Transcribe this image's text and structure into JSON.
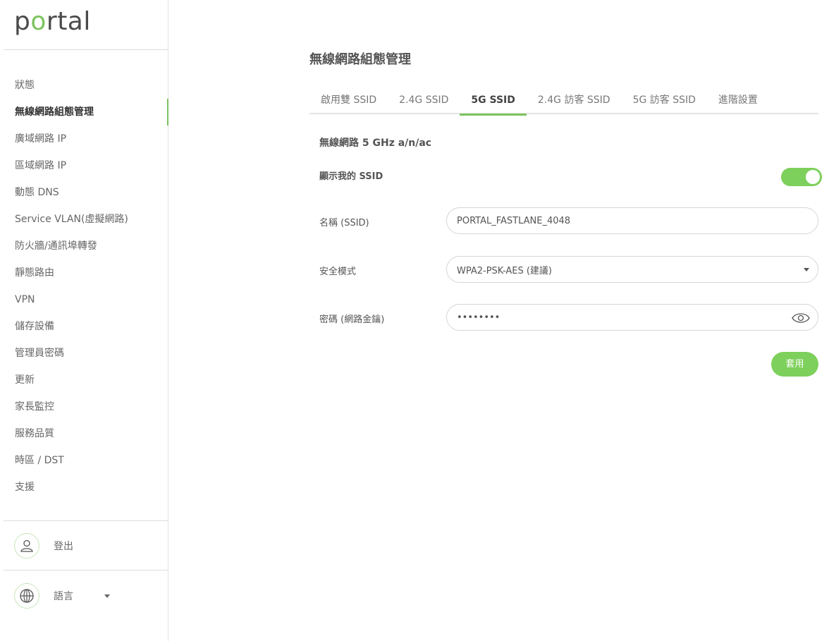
{
  "brand": {
    "logo_prefix": "p",
    "logo_o": "o",
    "logo_suffix": "rtal",
    "accent": "#7cc45e"
  },
  "sidebar": {
    "items": [
      {
        "label": "狀態",
        "active": false
      },
      {
        "label": "無線網路組態管理",
        "active": true
      },
      {
        "label": "廣域網路 IP",
        "active": false
      },
      {
        "label": "區域網路 IP",
        "active": false
      },
      {
        "label": "動態 DNS",
        "active": false
      },
      {
        "label": "Service VLAN(虛擬網路)",
        "active": false
      },
      {
        "label": "防火牆/通訊埠轉發",
        "active": false
      },
      {
        "label": "靜態路由",
        "active": false
      },
      {
        "label": "VPN",
        "active": false
      },
      {
        "label": "儲存設備",
        "active": false
      },
      {
        "label": "管理員密碼",
        "active": false
      },
      {
        "label": "更新",
        "active": false
      },
      {
        "label": "家長監控",
        "active": false
      },
      {
        "label": "服務品質",
        "active": false
      },
      {
        "label": "時區 / DST",
        "active": false
      },
      {
        "label": "支援",
        "active": false
      }
    ],
    "logout_label": "登出",
    "language_label": "語言"
  },
  "main": {
    "title": "無線網路組態管理",
    "tabs": [
      {
        "label": "啟用雙 SSID",
        "active": false
      },
      {
        "label": "2.4G SSID",
        "active": false
      },
      {
        "label": "5G SSID",
        "active": true
      },
      {
        "label": "2.4G 訪客 SSID",
        "active": false
      },
      {
        "label": "5G 訪客 SSID",
        "active": false
      },
      {
        "label": "進階設置",
        "active": false
      }
    ],
    "section_title": "無線網路 5 GHz a/n/ac",
    "show_ssid_label": "顯示我的 SSID",
    "show_ssid_on": true,
    "ssid_label": "名稱 (SSID)",
    "ssid_value": "PORTAL_FASTLANE_4048",
    "security_label": "安全模式",
    "security_value": "WPA2-PSK-AES (建議)",
    "password_label": "密碼 (網路金鑰)",
    "password_value": "password",
    "apply_label": "套用"
  }
}
